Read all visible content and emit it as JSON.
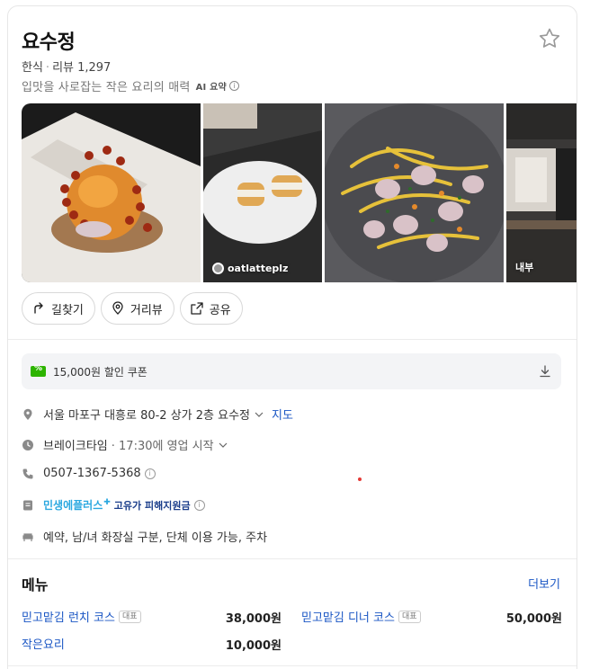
{
  "place": {
    "name": "요수정",
    "category": "한식",
    "separator": "·",
    "reviews_label": "리뷰 1,297",
    "summary": "입맛을 사로잡는 작은 요리의 매력",
    "ai_label": "AI 요약",
    "info_glyph": "i"
  },
  "photos": [
    {
      "caption": ""
    },
    {
      "caption": "oatlatteplz"
    },
    {
      "caption": ""
    },
    {
      "caption": "내부"
    }
  ],
  "actions": {
    "directions": "길찾기",
    "street_view": "거리뷰",
    "share": "공유"
  },
  "coupon": {
    "label": "15,000원 할인 쿠폰"
  },
  "details": {
    "address": "서울 마포구 대흥로 80-2 상가 2층 요수정",
    "map_link": "지도",
    "hours_status": "브레이크타임",
    "hours_detail": "· 17:30에 영업 시작",
    "phone": "0507-1367-5368",
    "promo_a": "민생에플러스",
    "promo_b": "고유가 피해지원금",
    "amenities": "예약, 남/녀 화장실 구분, 단체 이용 가능, 주차"
  },
  "menu": {
    "title": "메뉴",
    "more": "더보기",
    "items": [
      {
        "name": "믿고맡김 런치 코스",
        "tag": "대표",
        "price": "38,000원"
      },
      {
        "name": "믿고맡김 디너 코스",
        "tag": "대표",
        "price": "50,000원"
      },
      {
        "name": "작은요리",
        "tag": "",
        "price": "10,000원"
      }
    ]
  },
  "colors": {
    "link": "#1a56c4",
    "coupon_green": "#2db400",
    "muted": "#777777"
  },
  "icons": [
    "star-icon",
    "directions-icon",
    "street-view-icon",
    "share-icon",
    "coupon-icon",
    "download-icon",
    "location-pin-icon",
    "clock-icon",
    "phone-icon",
    "promo-icon",
    "amenities-icon",
    "chevron-down-icon"
  ]
}
